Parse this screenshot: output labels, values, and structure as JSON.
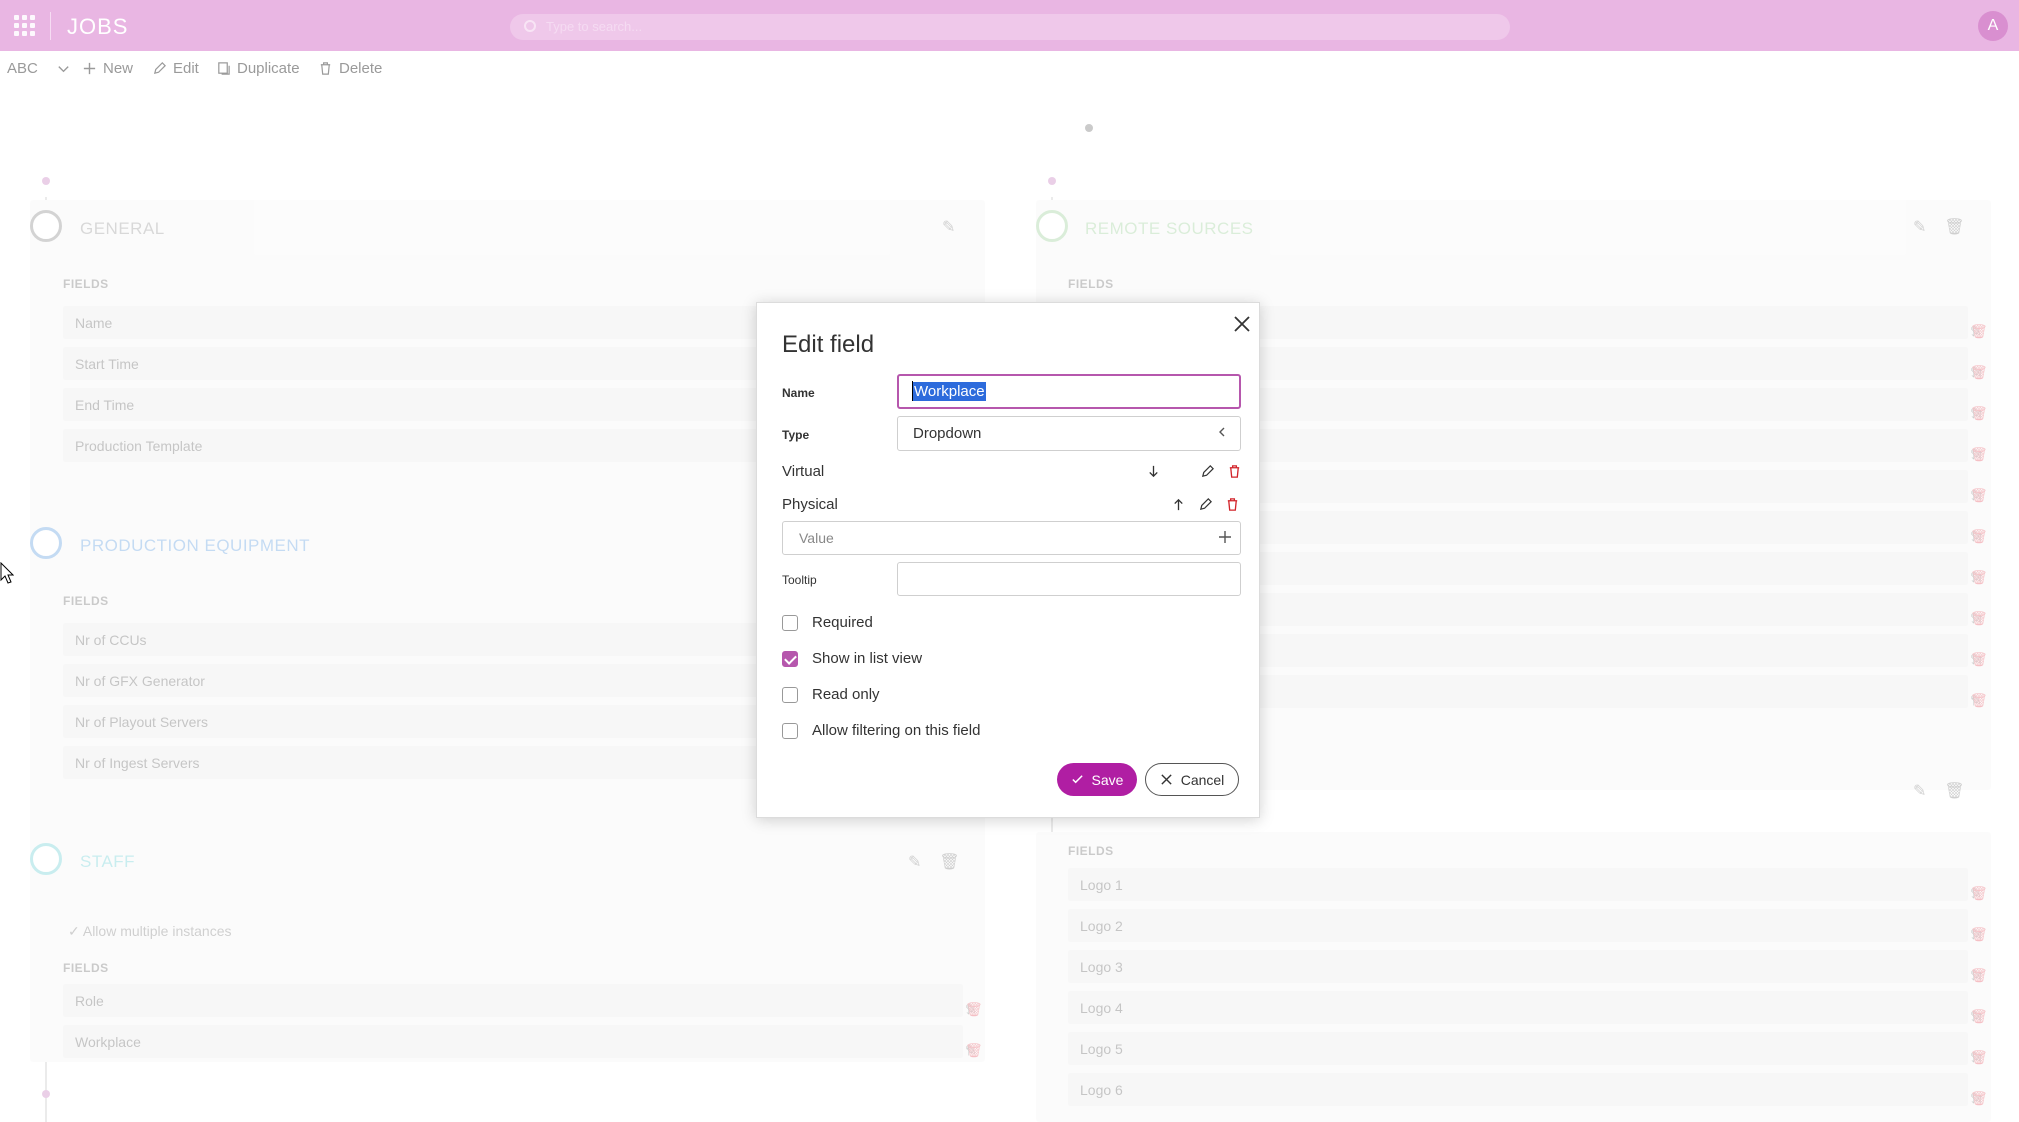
{
  "header": {
    "app_title": "JOBS",
    "search_placeholder": "Type to search...",
    "avatar_initial": "A",
    "accent_color": "#b657ad"
  },
  "toolbar": {
    "view_select": "ABC",
    "new_label": "New",
    "edit_label": "Edit",
    "duplicate_label": "Duplicate",
    "delete_label": "Delete"
  },
  "background": {
    "general": {
      "title": "GENERAL",
      "fields_label": "FIELDS",
      "rows": [
        "Name",
        "Start Time",
        "End Time",
        "Production Template"
      ]
    },
    "production_equipment": {
      "title": "PRODUCTION EQUIPMENT",
      "fields_label": "FIELDS",
      "rows": [
        "Nr of CCUs",
        "Nr of GFX Generator",
        "Nr of Playout Servers",
        "Nr of Ingest Servers"
      ]
    },
    "staff": {
      "title": "STAFF",
      "allow_multiple": "Allow multiple instances",
      "fields_label": "FIELDS",
      "rows": [
        "Role",
        "Workplace"
      ]
    },
    "remote_sources": {
      "title": "REMOTE SOURCES",
      "fields_label": "FIELDS"
    },
    "logos": {
      "fields_label": "FIELDS",
      "rows": [
        "Logo 1",
        "Logo 2",
        "Logo 3",
        "Logo 4",
        "Logo 5",
        "Logo 6"
      ]
    }
  },
  "modal": {
    "title": "Edit field",
    "name_label": "Name",
    "name_value": "Workplace",
    "type_label": "Type",
    "type_value": "Dropdown",
    "options": [
      {
        "label": "Virtual"
      },
      {
        "label": "Physical"
      }
    ],
    "value_placeholder": "Value",
    "tooltip_label": "Tooltip",
    "tooltip_value": "",
    "checkboxes": {
      "required": {
        "label": "Required",
        "checked": false
      },
      "show_in_list": {
        "label": "Show in list view",
        "checked": true
      },
      "read_only": {
        "label": "Read only",
        "checked": false
      },
      "allow_filtering": {
        "label": "Allow filtering on this field",
        "checked": false
      }
    },
    "save_label": "Save",
    "cancel_label": "Cancel"
  }
}
